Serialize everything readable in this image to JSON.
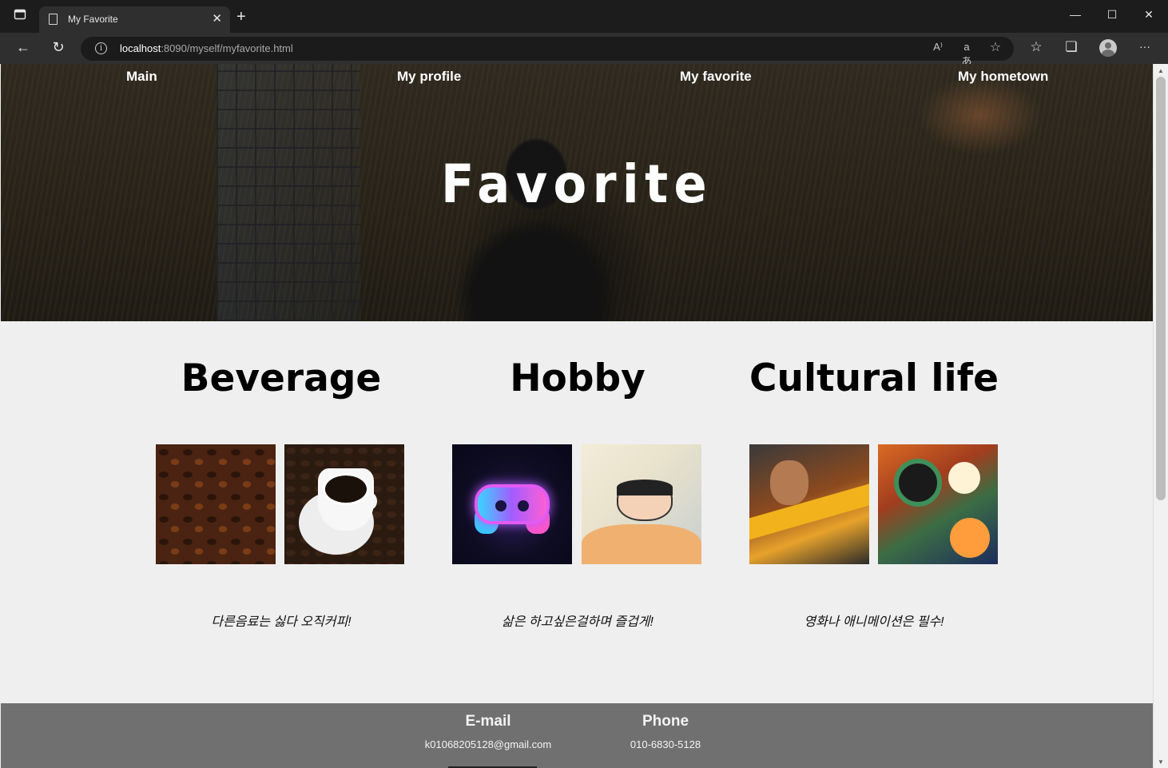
{
  "browser": {
    "tab_title": "My Favorite",
    "url_host": "localhost",
    "url_rest": ":8090/myself/myfavorite.html",
    "icons": {
      "sidebar": "tab-actions-icon",
      "close": "close-icon",
      "newtab": "plus-icon",
      "back": "back-arrow-icon",
      "reload": "reload-icon",
      "info": "info-icon",
      "read_aloud": "read-aloud-icon",
      "translate": "translate-icon",
      "add_favorite": "add-favorite-icon",
      "favorites": "favorites-icon",
      "collections": "collections-icon",
      "profile": "profile-icon",
      "more": "more-icon"
    },
    "glyphs": {
      "close": "✕",
      "newtab": "+",
      "minimize": "—",
      "maximize": "☐",
      "window_close": "✕",
      "back": "←",
      "reload": "↻",
      "info": "i",
      "read_aloud": "A⁾",
      "translate": "aあ",
      "add_favorite": "☆",
      "favorites": "☆",
      "collections": "❏",
      "more": "···"
    }
  },
  "page": {
    "nav": [
      "Main",
      "My profile",
      "My favorite",
      "My hometown"
    ],
    "hero_title": "Favorite",
    "sections": [
      {
        "title": "Beverage",
        "caption": "다른음료는 싫다 오직커피!",
        "images": [
          "coffee-beans-image",
          "coffee-cup-image"
        ]
      },
      {
        "title": "Hobby",
        "caption": "삶은 하고싶은걸하며 즐겁게!",
        "images": [
          "gamepad-image",
          "cartoon-boy-sleeping-image"
        ]
      },
      {
        "title": "Cultural life",
        "caption": "영화나 애니메이션은 필수!",
        "images": [
          "movie-poster-image",
          "anime-collage-image"
        ]
      }
    ],
    "footer": {
      "email_label": "E-mail",
      "email": "k01068205128@gmail.com",
      "phone_label": "Phone",
      "phone": "010-6830-5128"
    }
  },
  "colors": {
    "page_bg": "#efefef",
    "footer_bg": "#707070",
    "browser_bg": "#2f2f2f"
  }
}
